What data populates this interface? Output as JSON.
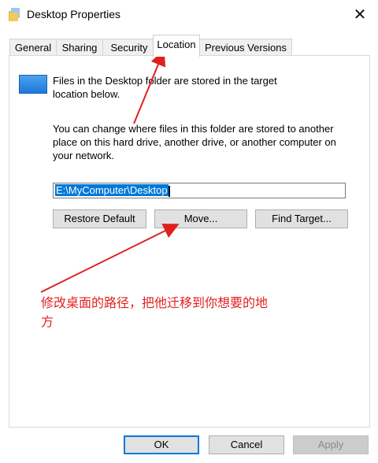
{
  "window": {
    "title": "Desktop Properties",
    "close_glyph": "✕"
  },
  "tabs": [
    {
      "label": "General"
    },
    {
      "label": "Sharing"
    },
    {
      "label": "Security"
    },
    {
      "label": "Location"
    },
    {
      "label": "Previous Versions"
    }
  ],
  "location": {
    "info": "Files in the Desktop folder are stored in the target location below.",
    "description": "You can change where files in this folder are stored to another place on this hard drive, another drive, or another computer on your network.",
    "path_value": "E:\\MyComputer\\Desktop",
    "restore_label": "Restore Default",
    "move_label": "Move...",
    "find_label": "Find Target..."
  },
  "annotation": {
    "text": "修改桌面的路径，把他迁移到你想要的地方",
    "color": "#e0201f"
  },
  "footer": {
    "ok_label": "OK",
    "cancel_label": "Cancel",
    "apply_label": "Apply"
  },
  "colors": {
    "accent": "#0078d7",
    "arrow": "#e0201f"
  }
}
